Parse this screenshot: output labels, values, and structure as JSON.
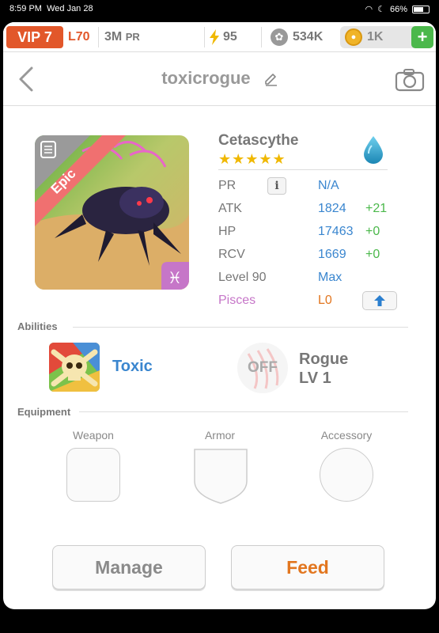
{
  "status_bar": {
    "time": "8:59 PM",
    "date": "Wed Jan 28",
    "battery": "66%"
  },
  "resources": {
    "vip": "VIP 7",
    "level": "L70",
    "pr_value": "3M",
    "pr_label": "PR",
    "energy": "95",
    "paws": "534K",
    "coins": "1K",
    "add_label": "+"
  },
  "header": {
    "title": "toxicrogue"
  },
  "monster": {
    "name": "Cetascythe",
    "rarity": "Epic",
    "stars": "★★★★★",
    "element": "water",
    "stats": [
      {
        "label": "PR",
        "value": "N/A",
        "bonus": ""
      },
      {
        "label": "ATK",
        "value": "1824",
        "bonus": "+21"
      },
      {
        "label": "HP",
        "value": "17463",
        "bonus": "+0"
      },
      {
        "label": "RCV",
        "value": "1669",
        "bonus": "+0"
      },
      {
        "label": "Level 90",
        "value": "Max",
        "bonus": ""
      },
      {
        "label": "Pisces",
        "value": "L0",
        "bonus": ""
      }
    ],
    "zodiac_symbol": "♓",
    "info_label": "i"
  },
  "abilities": {
    "section_label": "Abilities",
    "ability1": "Toxic",
    "ability2_state": "OFF",
    "ability2_name": "Rogue",
    "ability2_level": "LV 1"
  },
  "equipment": {
    "section_label": "Equipment",
    "slots": [
      "Weapon",
      "Armor",
      "Accessory"
    ]
  },
  "buttons": {
    "manage": "Manage",
    "feed": "Feed"
  },
  "colors": {
    "accent_orange": "#e2572a",
    "stat_blue": "#3a86cf",
    "bonus_green": "#4bb84b",
    "pisces_pink": "#c676c8",
    "epic_ribbon": "#f07070"
  }
}
